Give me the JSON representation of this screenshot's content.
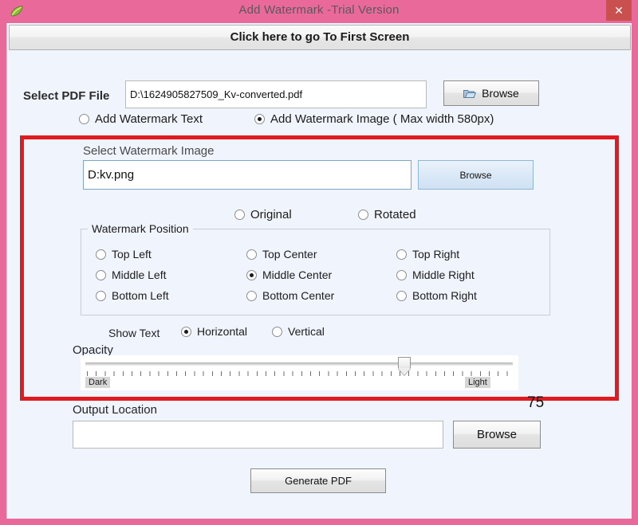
{
  "window": {
    "title": "Add Watermark  -Trial Version",
    "app_icon": "leaf-icon",
    "close_label": "✕",
    "titlebar_color": "#e8699a",
    "client_bg": "#f0f4fc",
    "highlight_color": "#e01b22"
  },
  "banner": {
    "label": "Click here to go To First Screen"
  },
  "pdf_file": {
    "label": "Select PDF File",
    "value": "D:\\1624905827509_Kv-converted.pdf",
    "placeholder": "",
    "browse_label": "Browse",
    "browse_icon": "folder-icon"
  },
  "mode_radios": [
    {
      "label": "Add Watermark Text",
      "checked": false
    },
    {
      "label": "Add Watermark Image ( Max width 580px)",
      "checked": true
    }
  ],
  "watermark_image": {
    "label": "Select Watermark Image",
    "value": "D:kv.png",
    "placeholder": "",
    "browse_label": "Browse"
  },
  "orientation_radios": [
    {
      "label": "Original",
      "checked": true
    },
    {
      "label": "Rotated",
      "checked": false
    }
  ],
  "position_group": {
    "legend": "Watermark Position",
    "options": [
      {
        "label": "Top Left",
        "checked": false
      },
      {
        "label": "Middle Left",
        "checked": false
      },
      {
        "label": "Bottom Left",
        "checked": false
      },
      {
        "label": "Top Center",
        "checked": false
      },
      {
        "label": "Middle Center",
        "checked": true
      },
      {
        "label": "Bottom Center",
        "checked": false
      },
      {
        "label": "Top Right",
        "checked": false
      },
      {
        "label": "Middle Right",
        "checked": false
      },
      {
        "label": "Bottom Right",
        "checked": false
      }
    ]
  },
  "show_text": {
    "label": "Show Text",
    "options": [
      {
        "label": "Horizontal",
        "checked": true
      },
      {
        "label": "Vertical",
        "checked": false
      }
    ]
  },
  "opacity": {
    "label": "Opacity",
    "value": "75",
    "min_label": "Dark",
    "max_label": "Light"
  },
  "output": {
    "label": "Output Location",
    "value": "",
    "placeholder": "",
    "browse_label": "Browse"
  },
  "generate": {
    "label": "Generate PDF"
  }
}
